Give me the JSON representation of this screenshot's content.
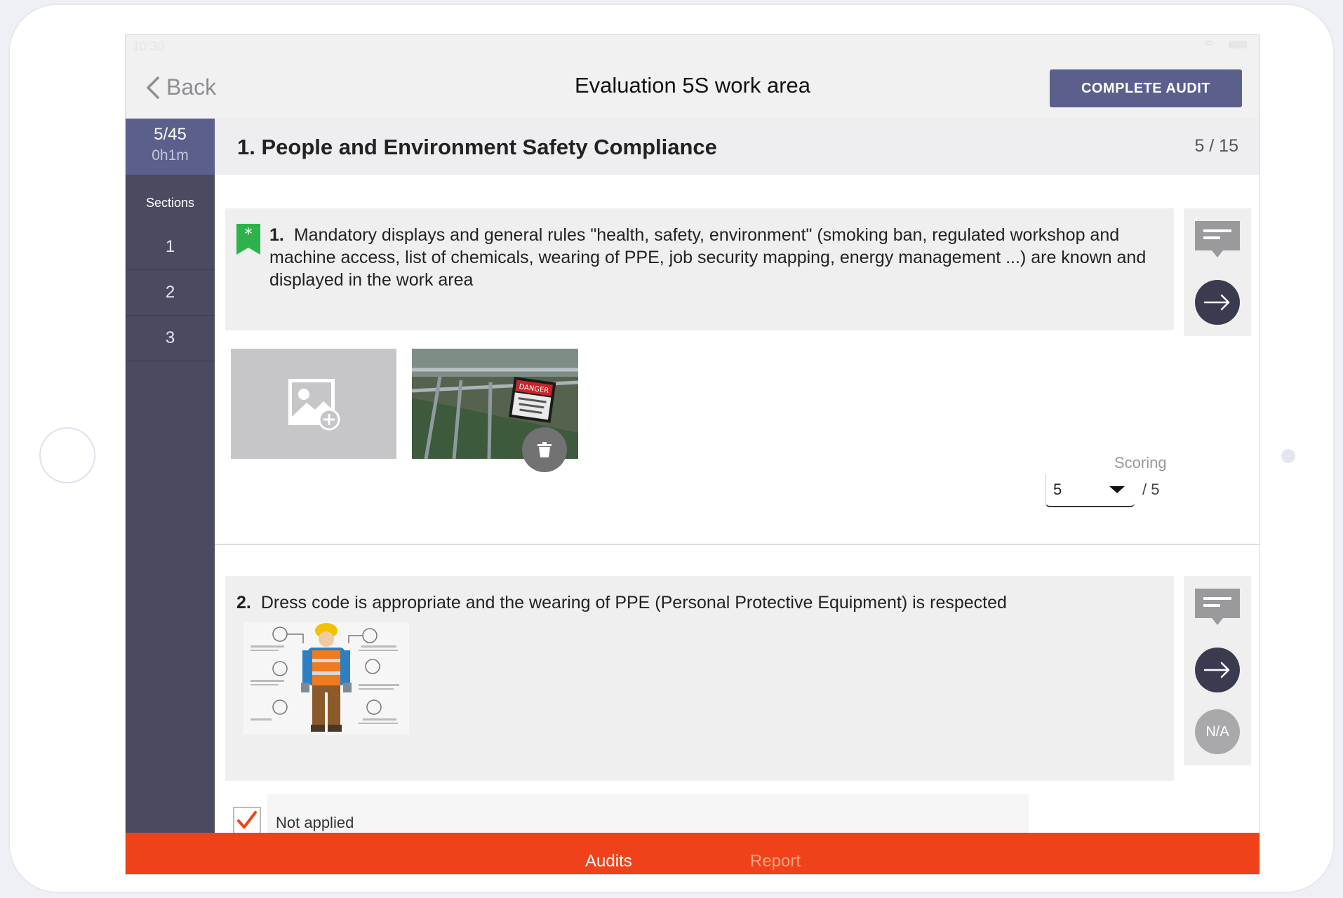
{
  "status_bar": {
    "time": "10:30"
  },
  "nav": {
    "back_label": "Back",
    "title": "Evaluation 5S work area",
    "complete_label": "COMPLETE AUDIT"
  },
  "sidebar": {
    "progress_count": "5/45",
    "progress_time": "0h1m",
    "sections_label": "Sections",
    "sections": [
      "1",
      "2",
      "3"
    ]
  },
  "section": {
    "title": "1. People and Environment Safety Compliance",
    "count": "5 / 15"
  },
  "questions": [
    {
      "number": "1.",
      "text": "Mandatory displays and general rules \"health, safety, environment\" (smoking ban, regulated workshop and machine access, list of chemicals, wearing of PPE, job security mapping, energy management ...) are known and displayed in the work area",
      "scoring_label": "Scoring",
      "score_value": "5",
      "score_max": "/ 5",
      "photo_sign": "DANGER"
    },
    {
      "number": "2.",
      "text": "Dress code is appropriate and the wearing of PPE (Personal Protective Equipment) is respected",
      "na_label": "N/A",
      "not_applied_label": "Not applied"
    }
  ],
  "tabs": {
    "audits": "Audits",
    "report": "Report"
  },
  "colors": {
    "accent": "#5b5f8c",
    "sidebar": "#4a4b61",
    "tabbar": "#f0421a",
    "flag": "#2db34a",
    "check": "#f0421a"
  },
  "icons": [
    "chevron-left-icon",
    "star-flag-icon",
    "comment-icon",
    "arrow-right-icon",
    "add-image-icon",
    "trash-icon",
    "check-icon"
  ]
}
